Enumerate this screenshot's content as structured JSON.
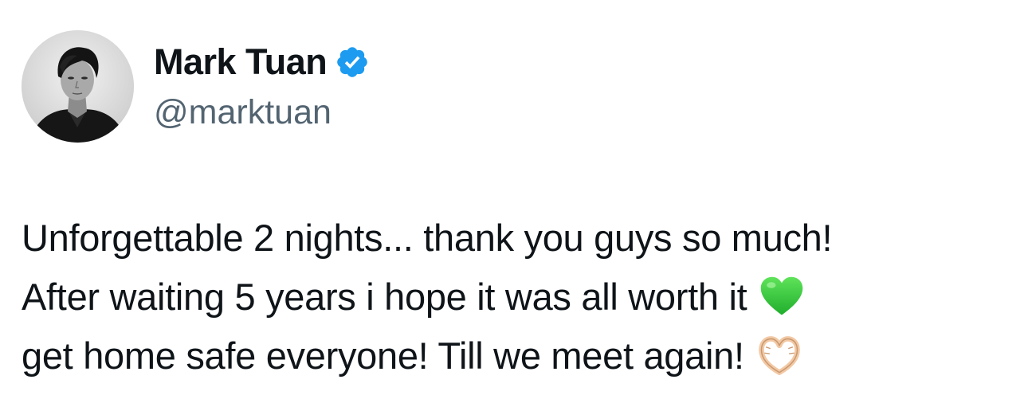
{
  "tweet": {
    "author": {
      "display_name": "Mark Tuan",
      "handle": "@marktuan",
      "verified": true,
      "verified_color": "#1d9bf0"
    },
    "text_lines": [
      {
        "text": "Unforgettable 2 nights... thank you guys so much!",
        "emoji": ""
      },
      {
        "text": "After waiting 5 years i hope it was all worth it",
        "emoji": "green-heart-icon"
      },
      {
        "text": "get home safe everyone! Till we meet again!",
        "emoji": "heart-hands-icon"
      }
    ]
  }
}
